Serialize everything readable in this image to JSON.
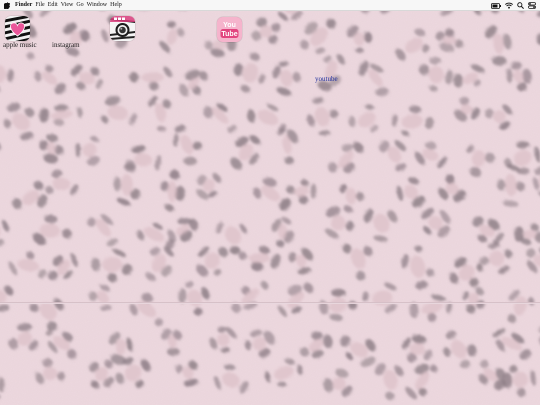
{
  "menubar": {
    "items": [
      "Finder",
      "File",
      "Edit",
      "View",
      "Go",
      "Window",
      "Help"
    ]
  },
  "status_icons": [
    "battery-icon",
    "wifi-icon",
    "search-icon",
    "control-center-icon"
  ],
  "desktop": {
    "wallpaper": "pink leopard print fur",
    "icons": [
      {
        "id": "apple-music",
        "label": "apple music",
        "icon": "zebra-heart-icon"
      },
      {
        "id": "instagram",
        "label": "instagram",
        "icon": "camera-icon"
      },
      {
        "id": "youtube",
        "label": "youtube",
        "icon": "youtube-icon"
      }
    ]
  },
  "youtube_badge": {
    "top": "You",
    "bottom": "Tube"
  },
  "colors": {
    "wallpaper_base": "#e9d3da",
    "spot_dark": "#8a7b83",
    "youtube_pink": "#e2457f",
    "youtube_label": "#1f2f9e"
  }
}
